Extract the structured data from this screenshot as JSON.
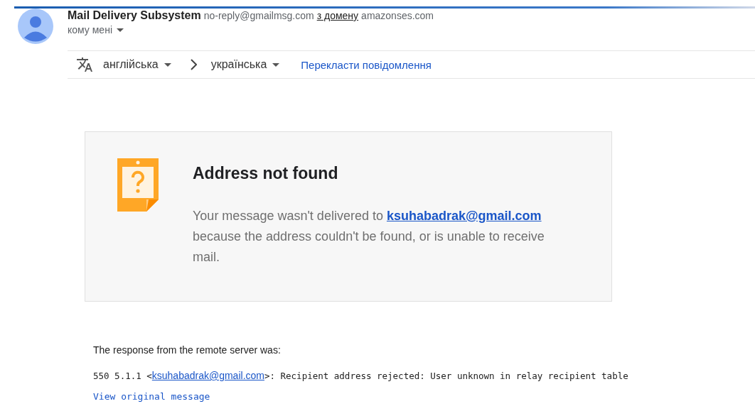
{
  "header": {
    "sender_name": "Mail Delivery Subsystem",
    "sender_email": "no-reply@gmailmsg.com",
    "via_label": "з домену",
    "via_domain": "amazonses.com",
    "recipient": "кому мені"
  },
  "translate_bar": {
    "source_language": "англійська",
    "target_language": "українська",
    "translate_link": "Перекласти повідомлення"
  },
  "notice": {
    "title": "Address not found",
    "text_before": "Your message wasn't delivered to ",
    "address": "ksuhabadrak@gmail.com",
    "text_after": " because the address couldn't be found, or is unable to receive mail."
  },
  "response": {
    "label": "The response from the remote server was:",
    "code_before": "550 5.1.1 <",
    "address": "ksuhabadrak@gmail.com",
    "code_after": ">: Recipient address rejected: User unknown in relay recipient table",
    "view_link": "View original message"
  }
}
